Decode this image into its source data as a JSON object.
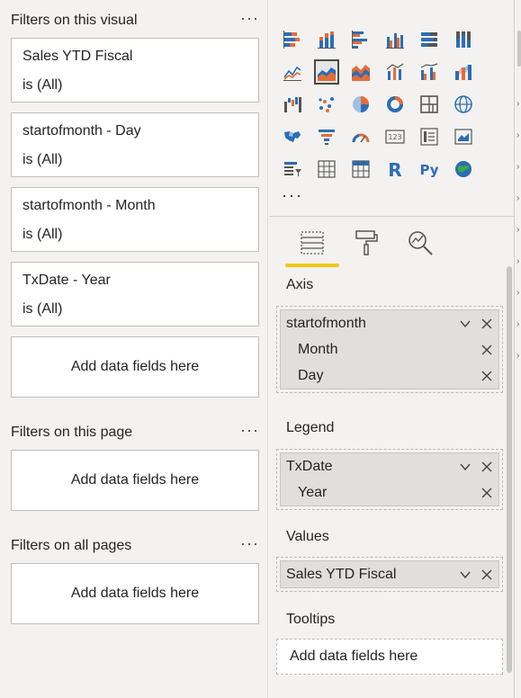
{
  "filters": {
    "visual": {
      "header": "Filters on this visual",
      "more": "···",
      "cards": [
        {
          "title": "Sales YTD Fiscal",
          "state": "is (All)"
        },
        {
          "title": "startofmonth - Day",
          "state": "is (All)"
        },
        {
          "title": "startofmonth - Month",
          "state": "is (All)"
        },
        {
          "title": "TxDate - Year",
          "state": "is (All)"
        }
      ],
      "add_label": "Add data fields here"
    },
    "page": {
      "header": "Filters on this page",
      "more": "···",
      "add_label": "Add data fields here"
    },
    "all_pages": {
      "header": "Filters on all pages",
      "more": "···",
      "add_label": "Add data fields here"
    }
  },
  "visualizations": {
    "gallery_more": "···",
    "icons": [
      "stacked-bar-chart-icon",
      "stacked-column-chart-icon",
      "clustered-bar-chart-icon",
      "clustered-column-chart-icon",
      "100-stacked-bar-chart-icon",
      "100-stacked-column-chart-icon",
      "line-chart-icon",
      "area-chart-icon",
      "stacked-area-chart-icon",
      "line-and-stacked-column-chart-icon",
      "line-and-clustered-column-chart-icon",
      "ribbon-chart-icon",
      "waterfall-chart-icon",
      "scatter-chart-icon",
      "pie-chart-icon",
      "donut-chart-icon",
      "treemap-icon",
      "map-icon",
      "filled-map-icon",
      "funnel-icon",
      "gauge-icon",
      "card-icon",
      "multi-row-card-icon",
      "kpi-icon",
      "slicer-icon",
      "table-icon",
      "matrix-icon",
      "r-visual-icon",
      "python-visual-icon",
      "arcgis-map-icon"
    ],
    "selected_icon": "area-chart-icon",
    "r_label": "R",
    "py_label": "Py",
    "card_label": "123",
    "tabs": [
      "fields-tab-icon",
      "format-paint-roller-icon",
      "analytics-magnifier-icon"
    ],
    "accent": "#f2c811",
    "wells": {
      "axis": {
        "label": "Axis",
        "group": "startofmonth",
        "children": [
          "Month",
          "Day"
        ]
      },
      "legend": {
        "label": "Legend",
        "group": "TxDate",
        "children": [
          "Year"
        ]
      },
      "values": {
        "label": "Values",
        "field": "Sales YTD Fiscal"
      },
      "tooltips": {
        "label": "Tooltips",
        "add_label": "Add data fields here"
      }
    }
  },
  "colors": {
    "bar_blue": "#2c6db4",
    "bar_orange": "#e66c37",
    "tab_accent": "#f2c811",
    "pane_bg": "#f3f2f1"
  }
}
